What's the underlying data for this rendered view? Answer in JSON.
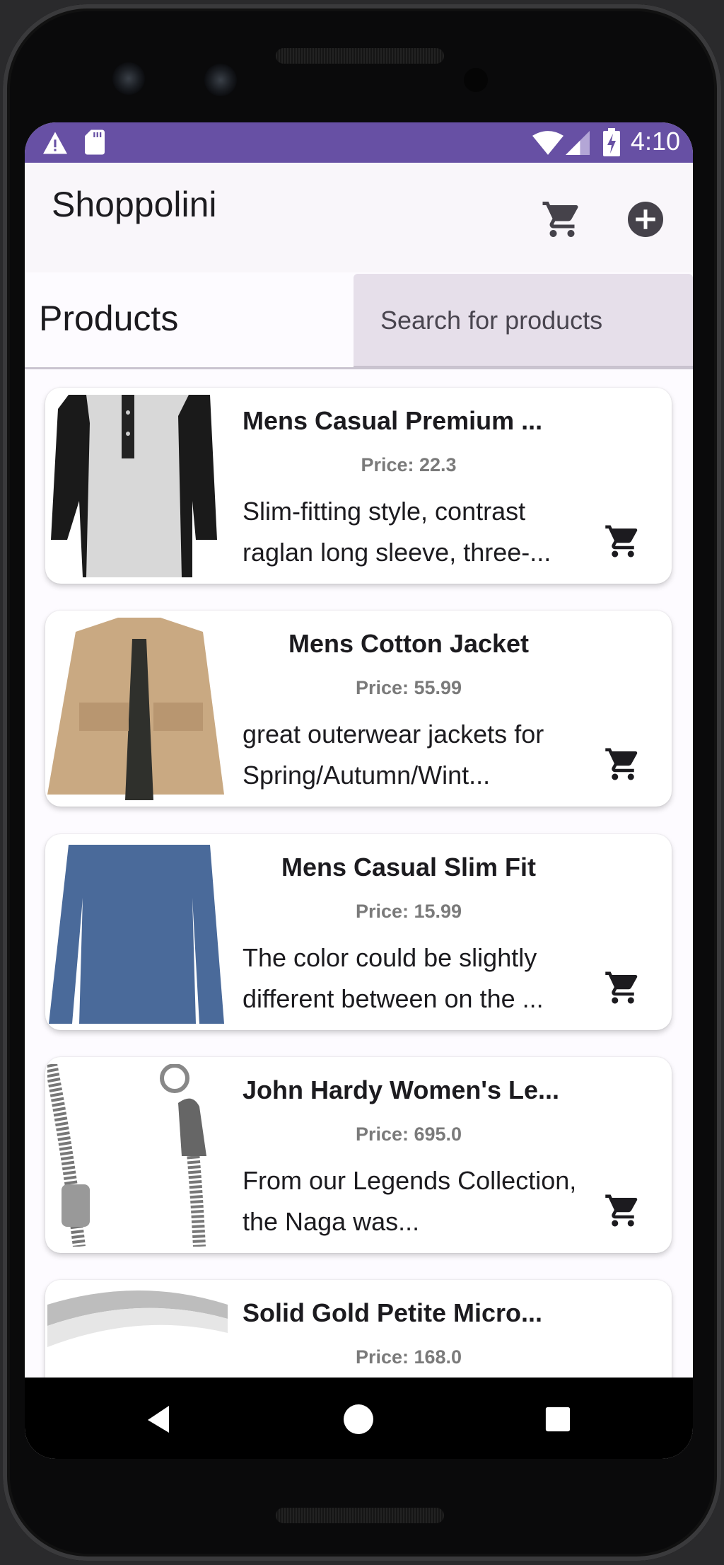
{
  "status_bar": {
    "time": "4:10",
    "left_icons": [
      "warning-icon",
      "sd-card-icon"
    ],
    "right_icons": [
      "wifi-icon",
      "cellular-signal-icon",
      "battery-charging-icon"
    ],
    "color": "#6750a4"
  },
  "app_bar": {
    "title": "Shoppolini",
    "actions": [
      {
        "name": "cart-icon",
        "label": "Cart"
      },
      {
        "name": "add-circle-icon",
        "label": "Add product"
      }
    ]
  },
  "products_header": {
    "title": "Products",
    "search": {
      "placeholder": "Search for products",
      "value": ""
    }
  },
  "products": [
    {
      "title": "Mens Casual Premium ...",
      "price": "Price: 22.3",
      "description": "Slim-fitting style, contrast raglan long sleeve, three-...",
      "image": "raglan-henley-shirt"
    },
    {
      "title": "Mens Cotton Jacket",
      "price": "Price: 55.99",
      "description": "great outerwear jackets for Spring/Autumn/Wint...",
      "image": "khaki-cotton-jacket"
    },
    {
      "title": "Mens Casual Slim Fit",
      "price": "Price: 15.99",
      "description": "The color could be slightly different between on the ...",
      "image": "blue-long-sleeve-tee"
    },
    {
      "title": "John Hardy Women's Le...",
      "price": "Price: 695.0",
      "description": "From our Legends Collection, the Naga was...",
      "image": "silver-dragon-bracelet"
    },
    {
      "title": "Solid Gold Petite Micro...",
      "price": "Price: 168.0",
      "description": "",
      "image": "gold-ring"
    }
  ],
  "nav_bar": {
    "buttons": [
      "back",
      "home",
      "recents"
    ]
  }
}
